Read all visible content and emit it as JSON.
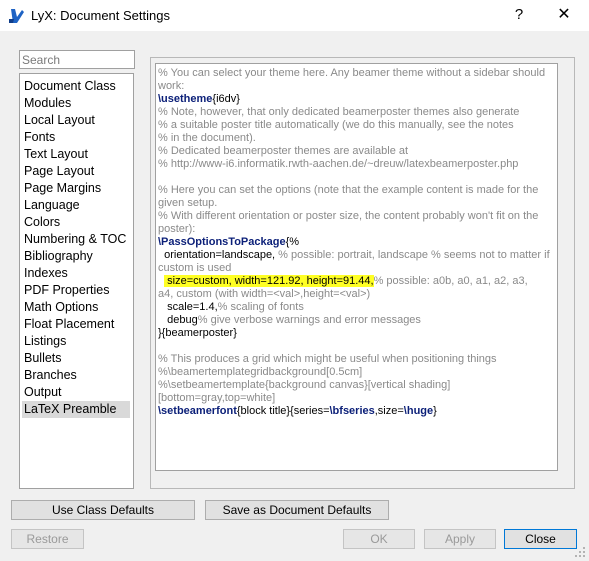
{
  "window": {
    "title": "LyX: Document Settings",
    "help_label": "?",
    "close_label": "✕"
  },
  "search": {
    "placeholder": "Search"
  },
  "sidebar": {
    "items": [
      {
        "label": "Document Class"
      },
      {
        "label": "Modules"
      },
      {
        "label": "Local Layout"
      },
      {
        "label": "Fonts"
      },
      {
        "label": "Text Layout"
      },
      {
        "label": "Page Layout"
      },
      {
        "label": "Page Margins"
      },
      {
        "label": "Language"
      },
      {
        "label": "Colors"
      },
      {
        "label": "Numbering & TOC"
      },
      {
        "label": "Bibliography"
      },
      {
        "label": "Indexes"
      },
      {
        "label": "PDF Properties"
      },
      {
        "label": "Math Options"
      },
      {
        "label": "Float Placement"
      },
      {
        "label": "Listings"
      },
      {
        "label": "Bullets"
      },
      {
        "label": "Branches"
      },
      {
        "label": "Output"
      },
      {
        "label": "LaTeX Preamble"
      }
    ],
    "selected": "LaTeX Preamble"
  },
  "preamble": {
    "l1": "% You can select your theme here. Any beamer theme without a sidebar should",
    "l2": "work:",
    "l3_cmd": "\\usetheme",
    "l3_arg": "{i6dv}",
    "l4": "% Note, however, that only dedicated beamerposter themes also generate",
    "l5": "% a suitable poster title automatically (we do this manually, see the notes",
    "l6": "% in the document).",
    "l7": "% Dedicated beamerposter themes are available at",
    "l8": "% http://www-i6.informatik.rwth-aachen.de/~dreuw/latexbeamerposter.php",
    "l9": "% Here you can set the options (note that the example content is made for the",
    "l10": "given setup.",
    "l11": "% With different orientation or poster size, the content probably won't fit on the",
    "l12": "poster):",
    "l13_cmd": "\\PassOptionsToPackage",
    "l13_arg": "{%",
    "l14_text": "  orientation=landscape, ",
    "l14_comment": "% possible: portrait, landscape % seems not to matter if",
    "l15": "custom is used",
    "l16_indent": "  ",
    "l16_hl": " size=custom, width=121.92, height=91.44,",
    "l16_comment": "% possible: a0b, a0, a1, a2, a3,",
    "l17": "a4, custom (with width=<val>,height=<val>)",
    "l18_text": "   scale=1.4,",
    "l18_comment": "% scaling of fonts",
    "l19_text": "   debug",
    "l19_comment": "% give verbose warnings and error messages",
    "l20": "}{beamerposter}",
    "l21": "% This produces a grid which might be useful when positioning things",
    "l22": "%\\beamertemplategridbackground[0.5cm]",
    "l23": "%\\setbeamertemplate{background canvas}[vertical shading]",
    "l24": "[bottom=gray,top=white]",
    "l25_cmd": "\\setbeamerfont",
    "l25_a": "{block title}{series=",
    "l25_cmd2": "\\bfseries",
    "l25_b": ",size=",
    "l25_cmd3": "\\huge",
    "l25_c": "}"
  },
  "buttons": {
    "use_class_defaults": "Use Class Defaults",
    "save_as_defaults": "Save as Document Defaults",
    "restore": "Restore",
    "ok": "OK",
    "apply": "Apply",
    "close": "Close"
  }
}
